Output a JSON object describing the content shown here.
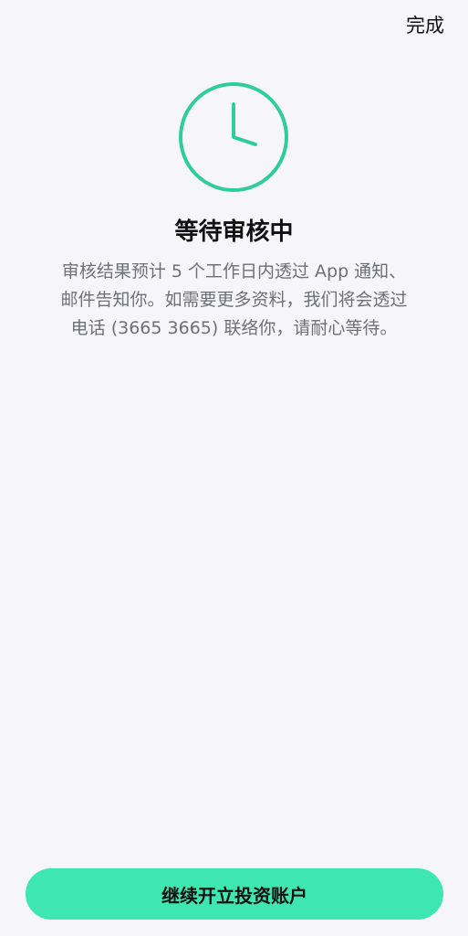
{
  "header": {
    "done_label": "完成"
  },
  "status": {
    "icon": "clock-icon",
    "accent_color": "#2fce98",
    "title": "等待审核中",
    "description": "审核结果预计 5 个工作日内透过 App 通知、邮件告知你。如需要更多资料，我们将会透过电话 (3665 3665) 联络你，请耐心等待。"
  },
  "footer": {
    "continue_label": "继续开立投资账户",
    "button_color": "#3ee6b0"
  }
}
